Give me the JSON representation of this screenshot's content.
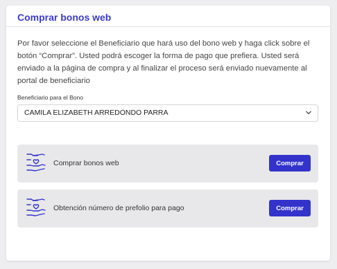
{
  "card": {
    "title": "Comprar bonos web",
    "intro": "Por favor seleccione el Beneficiario que hará uso del bono web y haga click sobre el botón “Comprar”. Usted podrá escoger la forma de pago que prefiera. Usted será enviado a la página de compra y al finalizar el proceso será enviado nuevamente al portal de beneficiario"
  },
  "beneficiary": {
    "label": "Beneficiario para el Bono",
    "selected": "CAMILA ELIZABETH ARREDONDO PARRA"
  },
  "options": [
    {
      "label": "Comprar bonos web",
      "button": "Comprar",
      "icon": "hand-heart-icon"
    },
    {
      "label": "Obtención número de prefolio para pago",
      "button": "Comprar",
      "icon": "hand-heart-icon"
    }
  ],
  "colors": {
    "accent": "#3a3ad0",
    "button": "#3333cc",
    "panel": "#e8e8ea",
    "background": "#eeeef0"
  }
}
